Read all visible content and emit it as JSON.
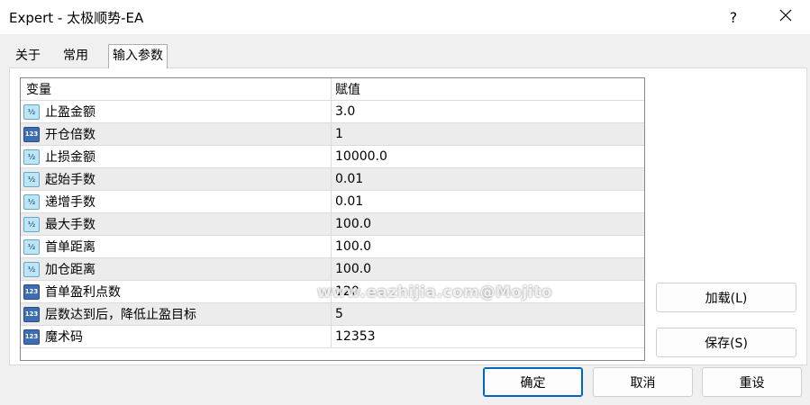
{
  "window": {
    "title": "Expert - 太极顺势-EA",
    "help_label": "?"
  },
  "tabs": [
    {
      "label": "关于"
    },
    {
      "label": "常用"
    },
    {
      "label": "输入参数"
    }
  ],
  "grid": {
    "columns": {
      "name": "变量",
      "value": "赋值"
    },
    "rows": [
      {
        "icon": "double-type-icon",
        "icon_text": "½",
        "name": "止盈金额",
        "value": "3.0"
      },
      {
        "icon": "integer-type-icon",
        "icon_text": "123",
        "name": "开仓倍数",
        "value": "1"
      },
      {
        "icon": "double-type-icon",
        "icon_text": "½",
        "name": "止损金额",
        "value": "10000.0"
      },
      {
        "icon": "double-type-icon",
        "icon_text": "½",
        "name": "起始手数",
        "value": "0.01"
      },
      {
        "icon": "double-type-icon",
        "icon_text": "½",
        "name": "递增手数",
        "value": "0.01"
      },
      {
        "icon": "double-type-icon",
        "icon_text": "½",
        "name": "最大手数",
        "value": "100.0"
      },
      {
        "icon": "double-type-icon",
        "icon_text": "½",
        "name": "首单距离",
        "value": "100.0"
      },
      {
        "icon": "double-type-icon",
        "icon_text": "½",
        "name": "加仓距离",
        "value": "100.0"
      },
      {
        "icon": "integer-type-icon",
        "icon_text": "123",
        "name": "首单盈利点数",
        "value": "120"
      },
      {
        "icon": "integer-type-icon",
        "icon_text": "123",
        "name": "层数达到后，降低止盈目标",
        "value": "5"
      },
      {
        "icon": "integer-type-icon",
        "icon_text": "123",
        "name": "魔术码",
        "value": "12353"
      }
    ]
  },
  "buttons": {
    "load": "加载(L)",
    "save": "保存(S)",
    "ok": "确定",
    "cancel": "取消",
    "reset": "重设"
  },
  "watermark": "www.eazhijia.com@Mojito",
  "colors": {
    "accent": "#0067c0",
    "double_icon": "#bfe4f3",
    "integer_icon": "#3d6fb0"
  }
}
